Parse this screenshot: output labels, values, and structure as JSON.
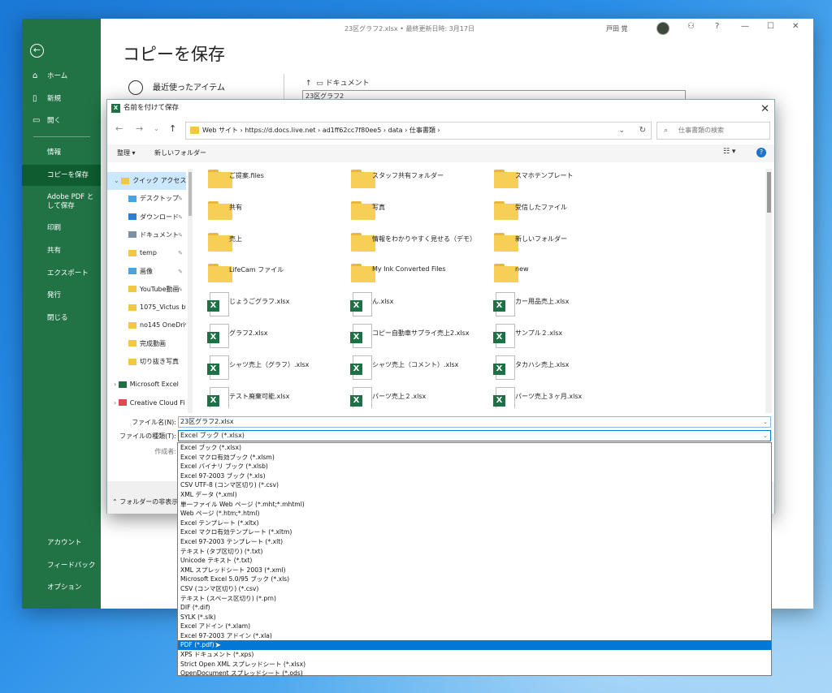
{
  "excel": {
    "doc_title": "23区グラフ2.xlsx • 最終更新日時: 3月17日",
    "user_name": "戸田 覚",
    "page_title": "コピーを保存",
    "recent_label": "最近使ったアイテム",
    "path_label": "ドキュメント",
    "filename_preview": "23区グラフ2",
    "nav": {
      "home": "ホーム",
      "new": "新規",
      "open": "開く",
      "info": "情報",
      "save_copy": "コピーを保存",
      "adobe_pdf": "Adobe PDF として保存",
      "print": "印刷",
      "share": "共有",
      "export": "エクスポート",
      "publish": "発行",
      "close": "閉じる",
      "account": "アカウント",
      "feedback": "フィードバック",
      "options": "オプション"
    }
  },
  "dialog": {
    "title": "名前を付けて保存",
    "address": "Web サイト  ›  https://d.docs.live.net  ›  ad1ff62cc7f80ee5  ›  data  ›  仕事書類  ›",
    "search_placeholder": "仕事書類の検索",
    "organize": "整理 ▾",
    "new_folder": "新しいフォルダー",
    "tree": [
      {
        "label": "クイック アクセス",
        "icon": "star-icon"
      },
      {
        "label": "デスクトップ",
        "icon": "desktop-icon"
      },
      {
        "label": "ダウンロード",
        "icon": "download-icon"
      },
      {
        "label": "ドキュメント",
        "icon": "documents-icon"
      },
      {
        "label": "temp",
        "icon": "folder-icon"
      },
      {
        "label": "画像",
        "icon": "pictures-icon"
      },
      {
        "label": "YouTube動画",
        "icon": "folder-icon"
      },
      {
        "label": "1075_Victus by",
        "icon": "folder-icon"
      },
      {
        "label": "no145 OneDriv",
        "icon": "folder-icon"
      },
      {
        "label": "完成動画",
        "icon": "folder-icon"
      },
      {
        "label": "切り抜き写真",
        "icon": "folder-icon"
      },
      {
        "label": "Microsoft Excel",
        "icon": "excel-icon"
      },
      {
        "label": "Creative Cloud Fi",
        "icon": "creative-cloud-icon"
      }
    ],
    "files": [
      {
        "name": "ご提案.files",
        "type": "folder"
      },
      {
        "name": "スタッフ共有フォルダー",
        "type": "folder"
      },
      {
        "name": "スマホテンプレート",
        "type": "folder"
      },
      {
        "name": "共有",
        "type": "folder"
      },
      {
        "name": "写真",
        "type": "folder"
      },
      {
        "name": "受信したファイル",
        "type": "folder"
      },
      {
        "name": "売上",
        "type": "folder"
      },
      {
        "name": "情報をわかりやすく見せる（デモ）",
        "type": "folder"
      },
      {
        "name": "新しいフォルダー",
        "type": "folder"
      },
      {
        "name": "LifeCam ファイル",
        "type": "folder"
      },
      {
        "name": "My Ink Converted Files",
        "type": "folder"
      },
      {
        "name": "new",
        "type": "folder"
      },
      {
        "name": "じょうごグラフ.xlsx",
        "type": "xlsx"
      },
      {
        "name": "ん.xlsx",
        "type": "xlsx"
      },
      {
        "name": "カー用品売上.xlsx",
        "type": "xlsx"
      },
      {
        "name": "グラフ2.xlsx",
        "type": "xlsx"
      },
      {
        "name": "コピー自動車サプライ売上2.xlsx",
        "type": "xlsx"
      },
      {
        "name": "サンプル２.xlsx",
        "type": "xlsx"
      },
      {
        "name": "シャツ売上（グラフ）.xlsx",
        "type": "xlsx"
      },
      {
        "name": "シャツ売上（コメント）.xlsx",
        "type": "xlsx"
      },
      {
        "name": "タカハシ売上.xlsx",
        "type": "xlsx"
      },
      {
        "name": "テスト廃棄可能.xlsx",
        "type": "xlsx"
      },
      {
        "name": "パーツ売上２.xlsx",
        "type": "xlsx"
      },
      {
        "name": "パーツ売上３ヶ月.xlsx",
        "type": "xlsx"
      }
    ],
    "filename_label": "ファイル名(N):",
    "filename_value": "23区グラフ2.xlsx",
    "filetype_label": "ファイルの種類(T):",
    "filetype_value": "Excel ブック (*.xlsx)",
    "author_label": "作成者:",
    "hide_folders": "フォルダーの非表示",
    "file_types": [
      "Excel ブック (*.xlsx)",
      "Excel マクロ有効ブック (*.xlsm)",
      "Excel バイナリ ブック (*.xlsb)",
      "Excel 97-2003 ブック (*.xls)",
      "CSV UTF-8 (コンマ区切り) (*.csv)",
      "XML データ (*.xml)",
      "単一ファイル Web ページ (*.mht;*.mhtml)",
      "Web ページ (*.htm;*.html)",
      "Excel テンプレート (*.xltx)",
      "Excel マクロ有効テンプレート (*.xltm)",
      "Excel 97-2003 テンプレート (*.xlt)",
      "テキスト (タブ区切り) (*.txt)",
      "Unicode テキスト (*.txt)",
      "XML スプレッドシート 2003 (*.xml)",
      "Microsoft Excel 5.0/95 ブック (*.xls)",
      "CSV (コンマ区切り) (*.csv)",
      "テキスト (スペース区切り) (*.prn)",
      "DIF (*.dif)",
      "SYLK (*.slk)",
      "Excel アドイン (*.xlam)",
      "Excel 97-2003 アドイン (*.xla)",
      "PDF (*.pdf)",
      "XPS ドキュメント (*.xps)",
      "Strict Open XML スプレッドシート (*.xlsx)",
      "OpenDocument スプレッドシート (*.ods)"
    ],
    "highlighted_type": "PDF (*.pdf)"
  }
}
